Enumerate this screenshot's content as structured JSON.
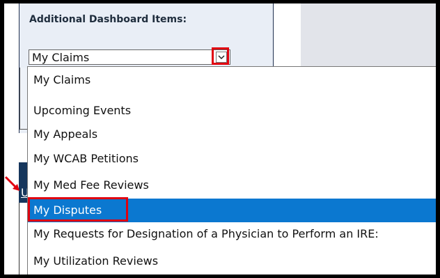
{
  "panel": {
    "title": "Additional Dashboard Items:"
  },
  "dropdown": {
    "selected": "My Claims"
  },
  "options": [
    "My Claims",
    "Upcoming Events",
    "My Appeals",
    "My WCAB Petitions",
    "My Med Fee Reviews",
    "My Disputes",
    "My Requests for Designation of a Physician to Perform an IRE:",
    "My Utilization Reviews"
  ],
  "highlighted_option_index": 5,
  "sidebar": {
    "link_text": "Us"
  },
  "colors": {
    "highlight": "#0b78d0",
    "annotation": "#e0000f",
    "navy": "#16365c"
  }
}
